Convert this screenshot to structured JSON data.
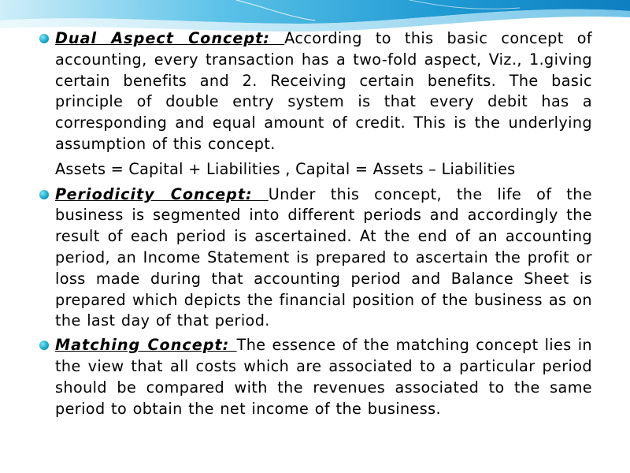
{
  "items": [
    {
      "term": "Dual Aspect Concept: ",
      "text": "According to this basic concept of accounting, every transaction has a two-fold aspect, Viz., 1.giving certain benefits and 2. Receiving certain benefits. The basic principle of double entry system is that every debit has a corresponding and equal amount of credit. This is the underlying assumption of this concept."
    },
    {
      "term": "Periodicity Concept: ",
      "text": "Under this concept, the life of the business is segmented into different periods and accordingly the result of each period is ascertained. At the end of an accounting period, an Income Statement is prepared to ascertain the profit or loss made during that accounting period and Balance Sheet is prepared which depicts the financial position of the business as on the last day of that period."
    },
    {
      "term": "Matching Concept: ",
      "text": "The essence of the matching concept lies in the view that all costs which are associated to a particular period should be compared with the revenues associated to the same period to obtain the net income of the business."
    }
  ],
  "equation": "Assets = Capital + Liabilities , Capital = Assets – Liabilities",
  "colors": {
    "bullet": "#1aa9c9",
    "header_wave": "#2aa6d8"
  }
}
